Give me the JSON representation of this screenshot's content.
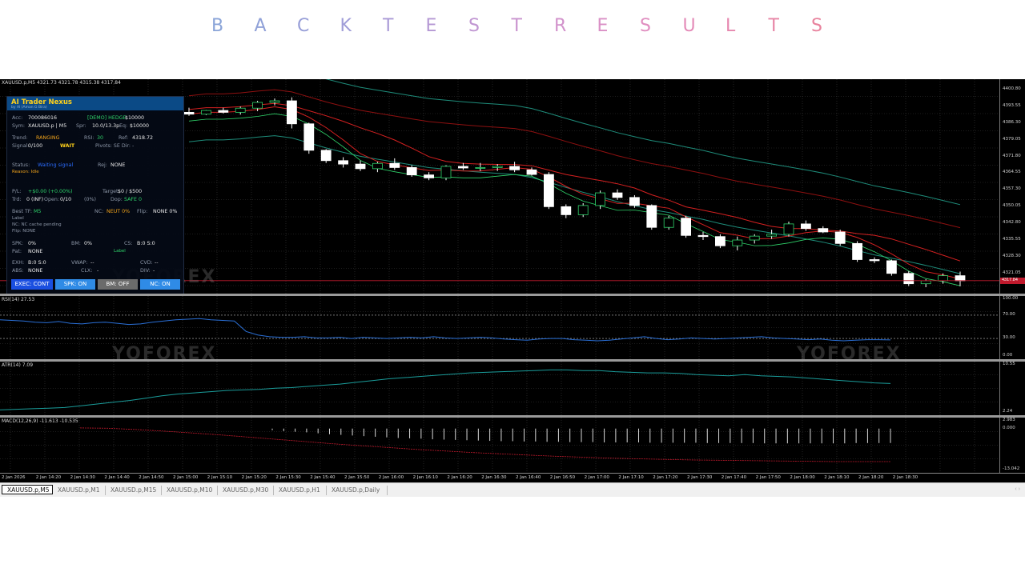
{
  "page_title": {
    "letters": [
      "B",
      "A",
      "C",
      "K",
      "T",
      "E",
      "S",
      "T",
      "R",
      "E",
      "S",
      "U",
      "L",
      "T",
      "S"
    ],
    "colors": [
      "#8aa4d8",
      "#90a1d8",
      "#989fd8",
      "#a09dd8",
      "#aa9ad6",
      "#b598d4",
      "#c096d2",
      "#c994cf",
      "#d292cb",
      "#da90c6",
      "#e08ec0",
      "#e48bb8",
      "#e688af",
      "#e785a6",
      "#e8829d"
    ]
  },
  "main_chart": {
    "header": "XAUUSD.p,M5  4321.73 4321.78 4315.38 4317.84",
    "price_axis_ticks": [
      "4400.80",
      "4393.55",
      "4386.30",
      "4379.05",
      "4371.80",
      "4364.55",
      "4357.30",
      "4350.05",
      "4342.80",
      "4335.55",
      "4328.30",
      "4321.05"
    ],
    "current_price_tag": "4317.84",
    "colors": {
      "bull_body": "#000000",
      "bear_body": "#ffffff",
      "wick": "#ffffff",
      "outline_bull": "#2fd36a",
      "outline_bear": "#ffffff",
      "ma_red": "#d42020",
      "ma_dark_red": "#8e1010",
      "bb_teal": "#1e8c7a",
      "bb_green": "#2fd36a",
      "bid_line": "#c0192c"
    },
    "chart_data": {
      "type": "candlestick",
      "ylim": [
        4315.0,
        4404.0
      ],
      "candles": [
        {
          "o": 4391.0,
          "h": 4393.0,
          "l": 4389.5,
          "c": 4390.2
        },
        {
          "o": 4390.2,
          "h": 4392.0,
          "l": 4389.8,
          "c": 4391.8
        },
        {
          "o": 4391.8,
          "h": 4393.0,
          "l": 4390.5,
          "c": 4391.0
        },
        {
          "o": 4391.0,
          "h": 4393.5,
          "l": 4390.0,
          "c": 4392.8
        },
        {
          "o": 4392.8,
          "h": 4396.0,
          "l": 4391.5,
          "c": 4395.3
        },
        {
          "o": 4395.3,
          "h": 4397.0,
          "l": 4394.0,
          "c": 4396.0
        },
        {
          "o": 4396.0,
          "h": 4397.5,
          "l": 4384.0,
          "c": 4386.0
        },
        {
          "o": 4386.0,
          "h": 4386.5,
          "l": 4373.0,
          "c": 4374.5
        },
        {
          "o": 4374.5,
          "h": 4375.0,
          "l": 4369.0,
          "c": 4370.0
        },
        {
          "o": 4370.0,
          "h": 4371.5,
          "l": 4367.0,
          "c": 4368.5
        },
        {
          "o": 4368.5,
          "h": 4370.0,
          "l": 4365.5,
          "c": 4366.5
        },
        {
          "o": 4366.5,
          "h": 4369.5,
          "l": 4365.0,
          "c": 4368.8
        },
        {
          "o": 4368.8,
          "h": 4371.0,
          "l": 4366.0,
          "c": 4367.0
        },
        {
          "o": 4367.0,
          "h": 4368.0,
          "l": 4363.0,
          "c": 4363.8
        },
        {
          "o": 4363.8,
          "h": 4365.0,
          "l": 4361.5,
          "c": 4362.5
        },
        {
          "o": 4362.5,
          "h": 4368.0,
          "l": 4361.5,
          "c": 4367.5
        },
        {
          "o": 4367.5,
          "h": 4369.0,
          "l": 4366.0,
          "c": 4366.8
        },
        {
          "o": 4366.8,
          "h": 4369.0,
          "l": 4365.5,
          "c": 4367.0
        },
        {
          "o": 4367.0,
          "h": 4368.5,
          "l": 4365.5,
          "c": 4367.5
        },
        {
          "o": 4367.5,
          "h": 4369.5,
          "l": 4365.0,
          "c": 4366.0
        },
        {
          "o": 4366.0,
          "h": 4367.0,
          "l": 4363.5,
          "c": 4364.0
        },
        {
          "o": 4364.0,
          "h": 4365.0,
          "l": 4349.0,
          "c": 4350.0
        },
        {
          "o": 4350.0,
          "h": 4351.0,
          "l": 4345.0,
          "c": 4346.5
        },
        {
          "o": 4346.5,
          "h": 4351.5,
          "l": 4345.5,
          "c": 4350.5
        },
        {
          "o": 4350.5,
          "h": 4357.0,
          "l": 4349.0,
          "c": 4356.0
        },
        {
          "o": 4356.0,
          "h": 4357.5,
          "l": 4353.0,
          "c": 4354.0
        },
        {
          "o": 4354.0,
          "h": 4355.0,
          "l": 4349.5,
          "c": 4350.5
        },
        {
          "o": 4350.5,
          "h": 4351.0,
          "l": 4340.0,
          "c": 4341.0
        },
        {
          "o": 4341.0,
          "h": 4346.0,
          "l": 4340.0,
          "c": 4345.0
        },
        {
          "o": 4345.0,
          "h": 4346.0,
          "l": 4336.5,
          "c": 4337.5
        },
        {
          "o": 4337.5,
          "h": 4339.0,
          "l": 4335.5,
          "c": 4337.0
        },
        {
          "o": 4337.0,
          "h": 4338.0,
          "l": 4332.0,
          "c": 4333.0
        },
        {
          "o": 4333.0,
          "h": 4337.0,
          "l": 4331.0,
          "c": 4335.5
        },
        {
          "o": 4335.5,
          "h": 4338.0,
          "l": 4334.0,
          "c": 4337.2
        },
        {
          "o": 4337.2,
          "h": 4340.0,
          "l": 4336.0,
          "c": 4338.0
        },
        {
          "o": 4338.0,
          "h": 4343.5,
          "l": 4337.0,
          "c": 4342.5
        },
        {
          "o": 4342.5,
          "h": 4344.0,
          "l": 4339.5,
          "c": 4340.5
        },
        {
          "o": 4340.5,
          "h": 4341.5,
          "l": 4338.5,
          "c": 4339.0
        },
        {
          "o": 4339.0,
          "h": 4340.0,
          "l": 4333.0,
          "c": 4334.0
        },
        {
          "o": 4334.0,
          "h": 4335.0,
          "l": 4326.0,
          "c": 4327.0
        },
        {
          "o": 4327.0,
          "h": 4328.0,
          "l": 4325.5,
          "c": 4326.5
        },
        {
          "o": 4326.5,
          "h": 4327.0,
          "l": 4320.0,
          "c": 4321.0
        },
        {
          "o": 4321.0,
          "h": 4322.0,
          "l": 4315.5,
          "c": 4316.5
        },
        {
          "o": 4316.5,
          "h": 4318.5,
          "l": 4315.0,
          "c": 4317.8
        },
        {
          "o": 4317.8,
          "h": 4321.0,
          "l": 4316.5,
          "c": 4320.0
        },
        {
          "o": 4320.0,
          "h": 4321.8,
          "l": 4315.4,
          "c": 4317.8
        }
      ]
    }
  },
  "rsi_pane": {
    "label": "RSI(14) 27.53",
    "axis_ticks": [
      "100.00",
      "70.00",
      "30.00",
      "0.00"
    ],
    "chart_data": {
      "type": "line",
      "ylim": [
        0,
        100
      ],
      "levels": [
        70,
        30
      ],
      "values": [
        62,
        61,
        60,
        58,
        57,
        59,
        56,
        55,
        57,
        58,
        56,
        54,
        55,
        58,
        60,
        62,
        63,
        64,
        62,
        61,
        60,
        42,
        36,
        33,
        32,
        32,
        33,
        31,
        31,
        32,
        30,
        32,
        31,
        30,
        31,
        32,
        31,
        33,
        31,
        30,
        31,
        32,
        31,
        29,
        28,
        27,
        29,
        30,
        30,
        28,
        27,
        26,
        27,
        29,
        31,
        33,
        30,
        28,
        29,
        31,
        30,
        29,
        30,
        31,
        32,
        33,
        31,
        30,
        29,
        28,
        29,
        27,
        26,
        27,
        28,
        28,
        27.5
      ]
    }
  },
  "atr_pane": {
    "label": "ATR(14) 7.09",
    "axis_ticks": [
      "10.55",
      "2.24"
    ],
    "chart_data": {
      "type": "line",
      "ylim": [
        2.24,
        10.55
      ],
      "values": [
        2.6,
        2.7,
        2.8,
        2.9,
        3.0,
        3.3,
        3.6,
        3.9,
        4.2,
        4.6,
        5.0,
        5.3,
        5.5,
        5.7,
        5.9,
        6.0,
        6.1,
        6.3,
        6.4,
        6.6,
        6.8,
        7.0,
        7.3,
        7.6,
        7.9,
        8.1,
        8.3,
        8.5,
        8.7,
        8.9,
        9.0,
        9.1,
        9.2,
        9.3,
        9.4,
        9.4,
        9.3,
        9.3,
        9.1,
        9.0,
        8.9,
        8.9,
        8.8,
        8.6,
        8.5,
        8.4,
        8.6,
        8.4,
        8.3,
        8.2,
        8.0,
        7.8,
        7.6,
        7.4,
        7.2,
        7.09
      ]
    }
  },
  "macd_pane": {
    "label": "MACD(12,26,9) -11.613 -10.535",
    "axis_ticks": [
      "2.983",
      "0.000",
      "-13.042"
    ],
    "chart_data": {
      "type": "bar+line",
      "ylim": [
        -13.042,
        2.983
      ],
      "histogram": [
        -0.5,
        -0.8,
        -1.0,
        -1.2,
        -1.5,
        -1.8,
        -2.0,
        -2.2,
        -2.4,
        -2.6,
        -2.8,
        -3.0,
        -3.1,
        -3.2,
        -3.4,
        -3.5,
        -3.6,
        -3.7,
        -3.8,
        -3.9,
        -4.0,
        -4.0,
        -4.1,
        -4.1,
        -4.2,
        -4.2,
        -4.3,
        -4.3,
        -4.3,
        -4.4,
        -4.4,
        -4.4,
        -4.4,
        -4.5,
        -4.5,
        -4.5,
        -4.5,
        -4.5,
        -4.6,
        -4.6,
        -4.6,
        -4.6,
        -4.6,
        -4.7,
        -4.7,
        -4.7,
        -4.7,
        -4.7,
        -4.7,
        -4.7,
        -4.7,
        -4.6,
        -4.6,
        -4.6,
        -4.6
      ],
      "signal": [
        0.2,
        0.1,
        -0.3,
        -0.8,
        -1.4,
        -2.0,
        -2.7,
        -3.4,
        -4.1,
        -4.8,
        -5.4,
        -6.0,
        -6.6,
        -7.1,
        -7.6,
        -8.0,
        -8.4,
        -8.8,
        -9.1,
        -9.4,
        -9.6,
        -9.8,
        -10.0,
        -10.1,
        -10.2,
        -10.3,
        -10.4,
        -10.5,
        -10.5,
        -10.5
      ]
    }
  },
  "time_axis": [
    "2 Jan 2026",
    "2 Jan 14:20",
    "2 Jan 14:30",
    "2 Jan 14:40",
    "2 Jan 14:50",
    "2 Jan 15:00",
    "2 Jan 15:10",
    "2 Jan 15:20",
    "2 Jan 15:30",
    "2 Jan 15:40",
    "2 Jan 15:50",
    "2 Jan 16:00",
    "2 Jan 16:10",
    "2 Jan 16:20",
    "2 Jan 16:30",
    "2 Jan 16:40",
    "2 Jan 16:50",
    "2 Jan 17:00",
    "2 Jan 17:10",
    "2 Jan 17:20",
    "2 Jan 17:30",
    "2 Jan 17:40",
    "2 Jan 17:50",
    "2 Jan 18:00",
    "2 Jan 18:10",
    "2 Jan 18:20",
    "2 Jan 18:30"
  ],
  "tabs": [
    "XAUUSD.p,M5",
    "XAUUSD.p,M1",
    "XAUUSD.p,M15",
    "XAUUSD.p,M10",
    "XAUUSD.p,M30",
    "XAUUSD.p,H1",
    "XAUUSD.p,Daily"
  ],
  "watermark": "YOFOREX",
  "panel": {
    "title": "AI Trader Nexus",
    "subtitle": "by AI (Aman G Bira)",
    "acc_label": "Acc:",
    "acc_value": "700086016",
    "acc_mode": "[DEMO] HEDGE",
    "acc_bal": "$10000",
    "sym_label": "Sym:",
    "sym_value": "XAUUSD.p | M5",
    "spr_label": "Spr:",
    "spr_value": "10.0/13.3p",
    "eq_label": "Eq:",
    "eq_value": "$10000",
    "trend_label": "Trend:",
    "trend_value": "RANGING",
    "rsi_label": "RSI:",
    "rsi_value": "30",
    "ref_label": "Ref:",
    "ref_value": "4318.72",
    "signal_label": "Signal:",
    "signal_value": "0/100",
    "wait": "WAIT",
    "pivots": "Pivots: SE Dir: -",
    "status_label": "Status:",
    "status_value": "Waiting signal",
    "rej_label": "Rej:",
    "rej_value": "NONE",
    "reason": "Reason: Idle",
    "pl_label": "P/L:",
    "pl_value": "+$0.00 (+0.00%)",
    "target_label": "Target:",
    "target_value": "$0 / $500",
    "trd_label": "Trd:",
    "trd_value": "0 (INF)",
    "open_label": "Open:",
    "open_value": "0/10",
    "pct": "(0%)",
    "dop_label": "Dop:",
    "dop_value": "SAFE 0",
    "besttf_label": "Best TF:",
    "besttf_value": "M5",
    "nc_label": "NC:",
    "nc_value": "NEUT 0%",
    "flip_label": "Flip:",
    "flip_value": "NONE 0%",
    "lbl": "Label",
    "nc_cache": "NC: NC cache pending",
    "flip_none": "Flip: NONE",
    "spk_label": "SPK:",
    "spk_value": "0%",
    "bm_label": "BM:",
    "bm_value": "0%",
    "cs_label": "CS:",
    "cs_value": "B:0 S:0",
    "pat_label": "Pat:",
    "pat_value": "NONE",
    "label2": "Label",
    "exh_label": "EXH:",
    "exh_value": "B:0 S:0",
    "vwap_label": "VWAP:",
    "vwap_value": "--",
    "cvd_label": "CVD:",
    "cvd_value": "--",
    "abs_label": "ABS:",
    "abs_value": "NONE",
    "clx_label": "CLX:",
    "clx_value": "-",
    "div_label": "DIV:",
    "div_value": "-",
    "buttons": [
      {
        "label": "EXEC: CONT",
        "color": "#1a4fe0"
      },
      {
        "label": "SPK: ON",
        "color": "#2f8be6"
      },
      {
        "label": "BM: OFF",
        "color": "#6b6b6b"
      },
      {
        "label": "NC: ON",
        "color": "#2f8be6"
      }
    ]
  }
}
